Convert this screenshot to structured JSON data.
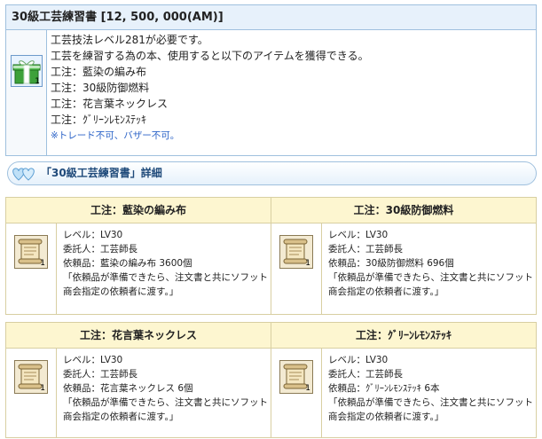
{
  "item": {
    "title": "30級工芸練習書 [12, 500, 000(AM)]",
    "quantity": "1",
    "lines": [
      "工芸技法レベル281が必要です。",
      "工芸を練習する為の本、使用すると以下のアイテムを獲得できる。",
      "工注：藍染の編み布",
      "工注：30級防御燃料",
      "工注：花言葉ネックレス",
      "工注：ｸﾞﾘｰﾝﾚﾓﾝｽﾃｯｷ"
    ],
    "note": "※トレード不可、バザー不可。"
  },
  "section": {
    "title": "「30級工芸練習書」詳細"
  },
  "cards": [
    {
      "title": "工注：藍染の編み布",
      "quantity": "1",
      "level": "レベル：LV30",
      "client": "委託人：工芸師長",
      "request": "依頼品：藍染の編み布 3600個",
      "quote1": "「依頼品が準備できたら、注文書と共にソフット",
      "quote2": "商会指定の依頼者に渡す。」"
    },
    {
      "title": "工注：30級防御燃料",
      "quantity": "1",
      "level": "レベル：LV30",
      "client": "委託人：工芸師長",
      "request": "依頼品：30級防御燃料 696個",
      "quote1": "「依頼品が準備できたら、注文書と共にソフット",
      "quote2": "商会指定の依頼者に渡す。」"
    },
    {
      "title": "工注：花言葉ネックレス",
      "quantity": "1",
      "level": "レベル：LV30",
      "client": "委託人：工芸師長",
      "request": "依頼品：花言葉ネックレス 6個",
      "quote1": "「依頼品が準備できたら、注文書と共にソフット",
      "quote2": "商会指定の依頼者に渡す。」"
    },
    {
      "title": "工注：ｸﾞﾘｰﾝﾚﾓﾝｽﾃｯｷ",
      "quantity": "1",
      "level": "レベル：LV30",
      "client": "委託人：工芸師長",
      "request": "依頼品：ｸﾞﾘｰﾝﾚﾓﾝｽﾃｯｷ 6本",
      "quote1": "「依頼品が準備できたら、注文書と共にソフット",
      "quote2": "商会指定の依頼者に渡す。」"
    }
  ],
  "icons": {
    "item": "gift-box-icon",
    "card": "scroll-icon",
    "section": "double-heart-icon"
  }
}
